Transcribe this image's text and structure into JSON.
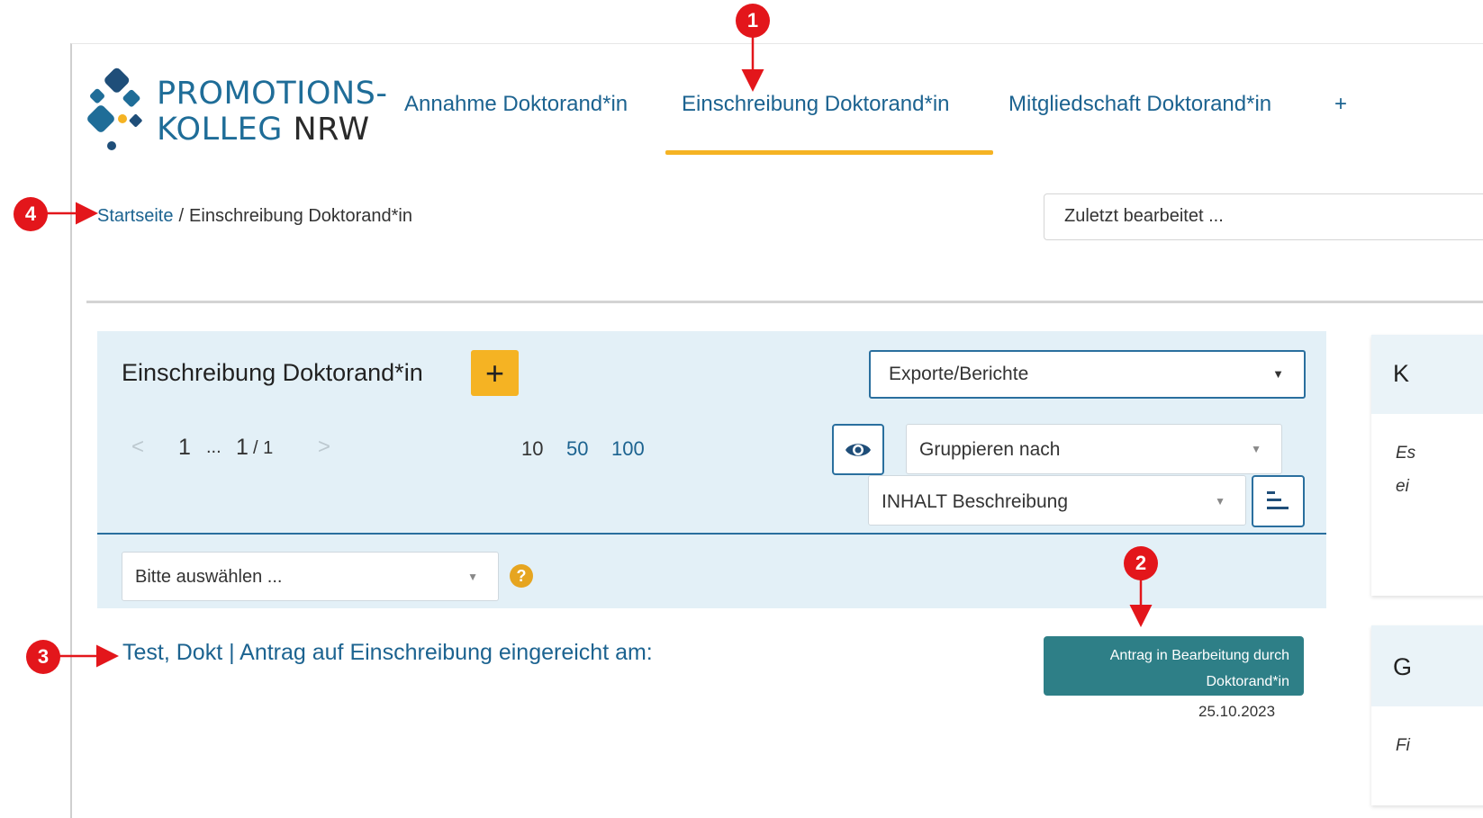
{
  "logo": {
    "line1": "PROMOTIONS-",
    "line2_a": "KOLLEG ",
    "line2_b": "NRW"
  },
  "nav": {
    "items": [
      {
        "label": "Annahme Doktorand*in"
      },
      {
        "label": "Einschreibung Doktorand*in"
      },
      {
        "label": "Mitgliedschaft Doktorand*in"
      }
    ],
    "add_label": "+"
  },
  "breadcrumb": {
    "home": "Startseite",
    "separator": "/",
    "current": "Einschreibung Doktorand*in"
  },
  "recent": {
    "placeholder": "Zuletzt bearbeitet ..."
  },
  "panel": {
    "title": "Einschreibung Doktorand*in",
    "add_button": "+",
    "export_select": "Exporte/Berichte",
    "pager": {
      "prev": "<",
      "first": "1",
      "ellipsis": "...",
      "current": "1",
      "total": "/ 1",
      "next": ">"
    },
    "page_sizes": [
      "10",
      "50",
      "100"
    ],
    "group_select": "Gruppieren nach",
    "content_select": "INHALT Beschreibung",
    "filter_select": "Bitte auswählen ...",
    "help": "?"
  },
  "results": [
    {
      "title": "Test, Dokt | Antrag auf Einschreibung eingereicht am:",
      "status_line1": "Antrag in Bearbeitung durch",
      "status_line2": "Doktorand*in",
      "date": "25.10.2023"
    }
  ],
  "side": {
    "card1_letter": "K",
    "card1_line1": "Es",
    "card1_line2": "ei",
    "card2_letter": "G",
    "card2_line1": "Fi"
  },
  "annotations": [
    "1",
    "2",
    "3",
    "4"
  ],
  "colors": {
    "brand_blue": "#1c6390",
    "accent_yellow": "#f5b323",
    "panel_bg": "#e3f0f7",
    "status_teal": "#2e7f87",
    "marker_red": "#e3161b"
  }
}
